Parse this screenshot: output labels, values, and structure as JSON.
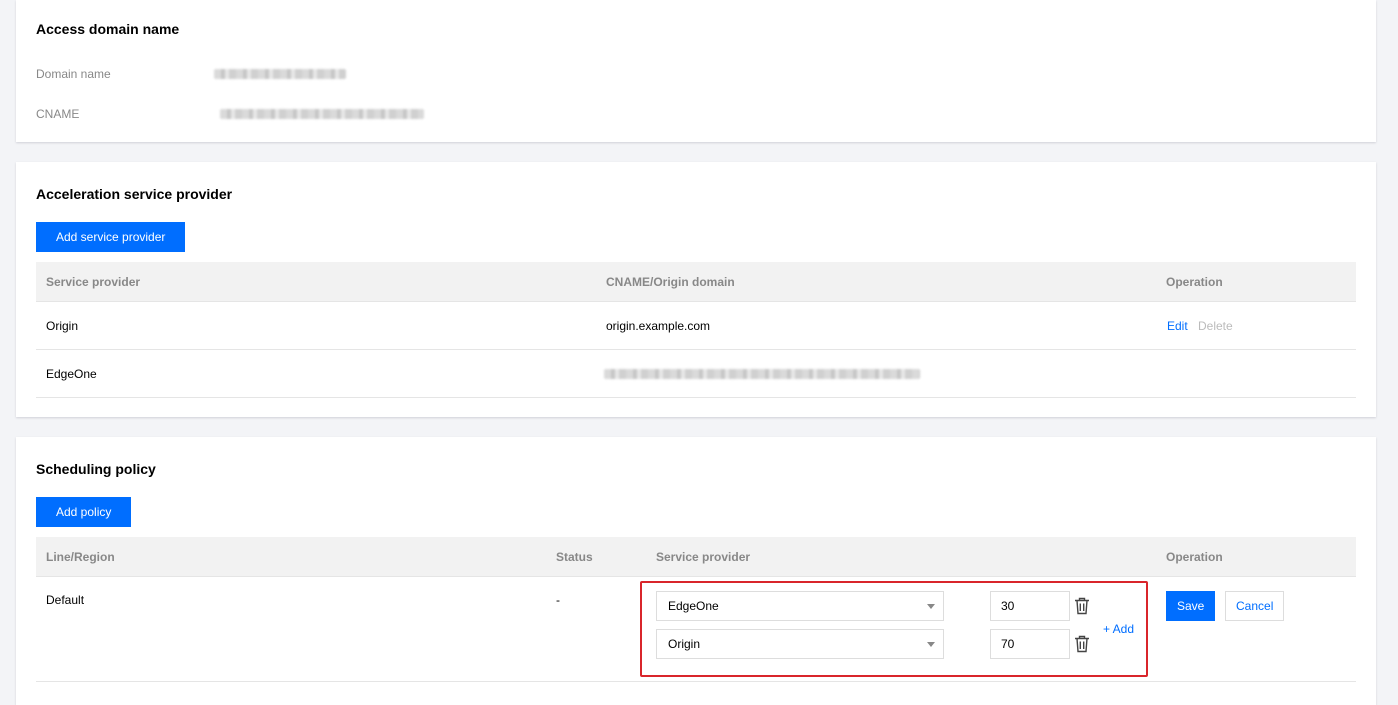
{
  "access": {
    "title": "Access domain name",
    "domain_label": "Domain name",
    "cname_label": "CNAME"
  },
  "providers": {
    "title": "Acceleration service provider",
    "add_button": "Add service provider",
    "headers": {
      "provider": "Service provider",
      "cname": "CNAME/Origin domain",
      "operation": "Operation"
    },
    "rows": [
      {
        "provider": "Origin",
        "domain": "origin.example.com",
        "edit": "Edit",
        "delete": "Delete"
      },
      {
        "provider": "EdgeOne"
      }
    ]
  },
  "policy": {
    "title": "Scheduling policy",
    "add_button": "Add policy",
    "headers": {
      "line": "Line/Region",
      "status": "Status",
      "provider": "Service provider",
      "operation": "Operation"
    },
    "row": {
      "line": "Default",
      "status": "-",
      "entries": [
        {
          "provider": "EdgeOne",
          "weight": "30"
        },
        {
          "provider": "Origin",
          "weight": "70"
        }
      ],
      "add_link": "+ Add",
      "save": "Save",
      "cancel": "Cancel"
    }
  },
  "colors": {
    "primary": "#006eff",
    "highlight": "#d9252b",
    "background": "#f3f4f7"
  }
}
